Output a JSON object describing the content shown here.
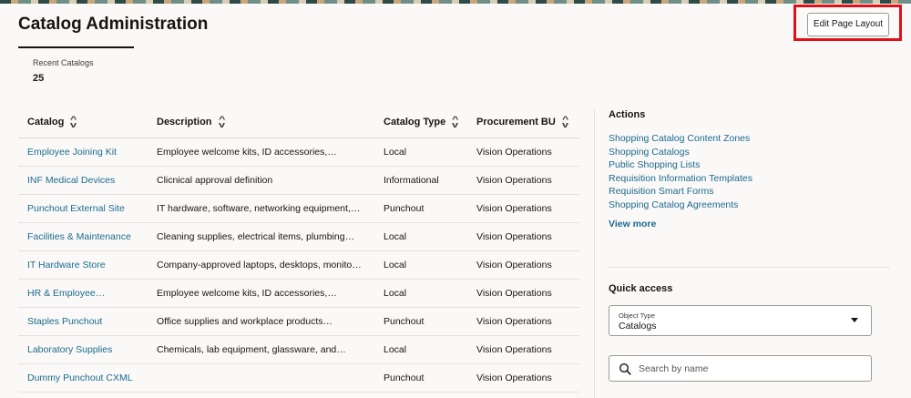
{
  "header": {
    "title": "Catalog Administration",
    "edit_layout_label": "Edit Page Layout"
  },
  "metric": {
    "label": "Recent Catalogs",
    "value": "25"
  },
  "table": {
    "columns": [
      "Catalog",
      "Description",
      "Catalog Type",
      "Procurement BU"
    ],
    "rows": [
      {
        "catalog": "Employee Joining Kit",
        "description": "Employee welcome kits, ID accessories,…",
        "type": "Local",
        "bu": "Vision Operations"
      },
      {
        "catalog": "INF Medical Devices",
        "description": "Clicnical approval definition",
        "type": "Informational",
        "bu": "Vision Operations"
      },
      {
        "catalog": "Punchout External Site",
        "description": "IT hardware, software, networking equipment,…",
        "type": "Punchout",
        "bu": "Vision Operations"
      },
      {
        "catalog": "Facilities & Maintenance",
        "description": "Cleaning supplies, electrical items, plumbing…",
        "type": "Local",
        "bu": "Vision Operations"
      },
      {
        "catalog": "IT Hardware Store",
        "description": "Company-approved laptops, desktops, monito…",
        "type": "Local",
        "bu": "Vision Operations"
      },
      {
        "catalog": "HR & Employee…",
        "description": "Employee welcome kits, ID accessories,…",
        "type": "Local",
        "bu": "Vision Operations"
      },
      {
        "catalog": "Staples Punchout",
        "description": "Office supplies and workplace products…",
        "type": "Punchout",
        "bu": "Vision Operations"
      },
      {
        "catalog": "Laboratory Supplies",
        "description": "Chemicals, lab equipment, glassware, and…",
        "type": "Local",
        "bu": "Vision Operations"
      },
      {
        "catalog": "Dummy Punchout CXML",
        "description": "",
        "type": "Punchout",
        "bu": "Vision Operations"
      }
    ]
  },
  "actions": {
    "title": "Actions",
    "links": [
      "Shopping Catalog Content Zones",
      "Shopping Catalogs",
      "Public Shopping Lists",
      "Requisition Information Templates",
      "Requisition Smart Forms",
      "Shopping Catalog Agreements"
    ],
    "view_more": "View more"
  },
  "quick_access": {
    "title": "Quick access",
    "object_type_label": "Object Type",
    "object_type_value": "Catalogs",
    "search_placeholder": "Search by name"
  },
  "colors": {
    "link": "#1b6a8e",
    "highlight": "#e0101a",
    "background": "#fbf9f8"
  },
  "icons": {
    "sort": "sort-icon",
    "caret": "chevron-down-icon",
    "search": "search-icon"
  }
}
